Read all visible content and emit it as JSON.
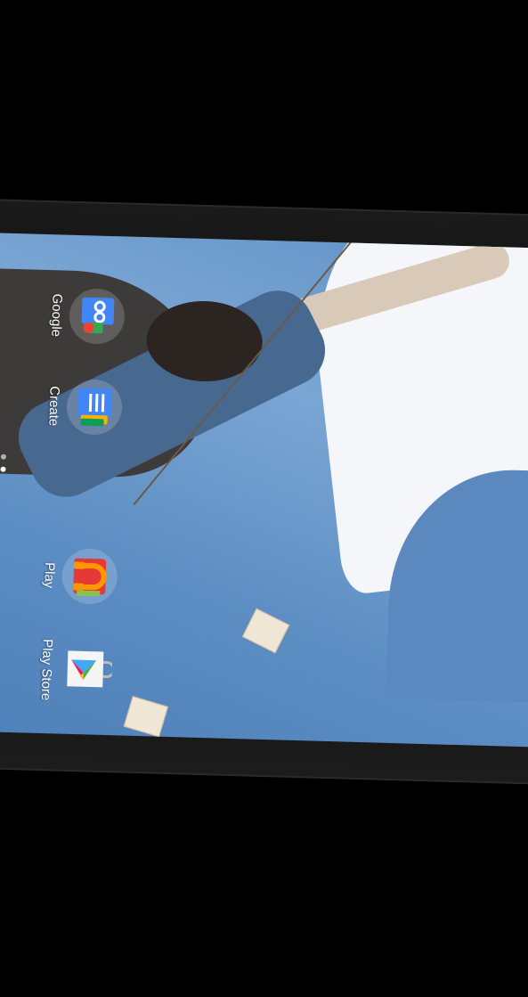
{
  "homescreen": {
    "apps": [
      {
        "label": "Google",
        "icon": "google-folder-icon"
      },
      {
        "label": "Create",
        "icon": "create-folder-icon"
      },
      {
        "label": "Play",
        "icon": "play-folder-icon"
      },
      {
        "label": "Play Store",
        "icon": "play-store-icon"
      }
    ]
  },
  "colors": {
    "sky": "#5f90c4",
    "bezel": "#111111",
    "label": "#ffffff"
  }
}
